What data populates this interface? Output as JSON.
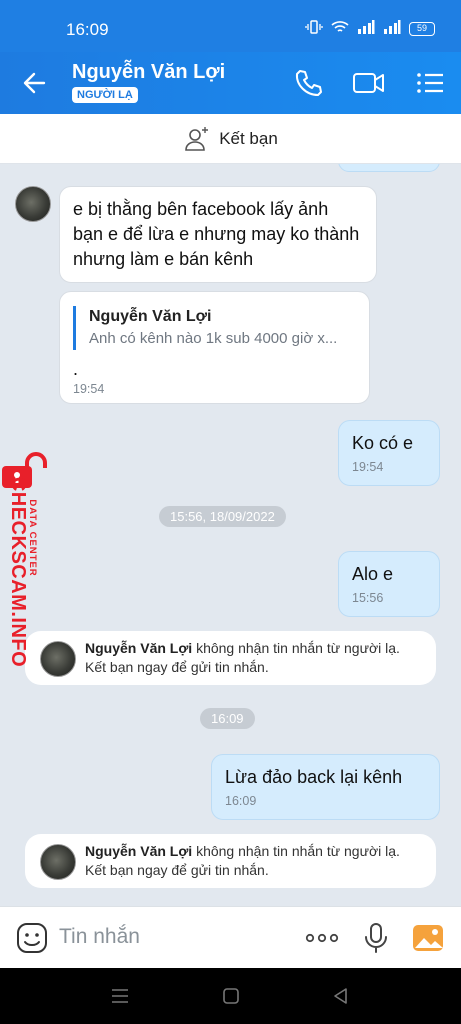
{
  "status": {
    "time": "16:09",
    "battery": "59"
  },
  "header": {
    "contact_name": "Nguyễn Văn Lợi",
    "badge": "NGƯỜI LẠ"
  },
  "add_friend": {
    "label": "Kết bạn"
  },
  "messages": [
    {
      "text": "e bị thằng bên facebook lấy ảnh bạn e để lừa e nhưng may ko thành nhưng làm e bán kênh"
    },
    {
      "quote_name": "Nguyễn Văn Lợi",
      "quote_text": "Anh có kênh nào 1k sub 4000 giờ x...",
      "text": ".",
      "time": "19:54"
    },
    {
      "text": "Ko có e",
      "time": "19:54"
    },
    {
      "text": "Alo e",
      "time": "15:56"
    },
    {
      "text": "Lừa đảo back lại kênh",
      "time": "16:09"
    }
  ],
  "separators": [
    "15:56, 18/09/2022",
    "16:09"
  ],
  "notice": {
    "name": "Nguyễn Văn Lợi",
    "text": " không nhận tin nhắn từ người lạ. Kết bạn ngay để gửi tin nhắn."
  },
  "watermark": {
    "brand": "CHECKSCAM.INFO",
    "sub": "DATA CENTER"
  },
  "input": {
    "placeholder": "Tin nhắn"
  },
  "colors": {
    "primary": "#1e7be0",
    "outgoing_bubble": "#d5ecfd",
    "watermark": "#e8202a"
  }
}
